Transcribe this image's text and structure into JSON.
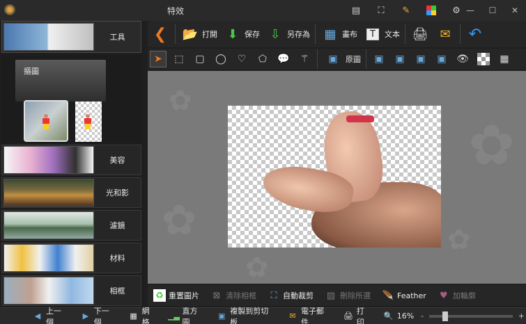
{
  "app": {
    "title": "特效"
  },
  "left": {
    "categories": [
      {
        "label": "工具"
      },
      {
        "label": "美容"
      },
      {
        "label": "光和影"
      },
      {
        "label": "濾鏡"
      },
      {
        "label": "材料"
      },
      {
        "label": "相框"
      }
    ],
    "crop_tab": "摳圖"
  },
  "toolbar": {
    "open": "打開",
    "save": "保存",
    "save_as": "另存為",
    "canvas": "畫布",
    "text": "文本",
    "original": "原圖"
  },
  "actions": {
    "reset": "重置圖片",
    "clear_frame": "清除相框",
    "auto_crop": "自動裁剪",
    "delete_selected": "刪除所選",
    "feather": "Feather",
    "add_outline": "加輪廓"
  },
  "status": {
    "prev": "上一個",
    "next": "下一個",
    "grid": "網格",
    "histogram": "直方圖",
    "copy_clipboard": "複製到剪切板",
    "email": "電子郵件",
    "print": "打印",
    "zoom": "16%",
    "zoom_minus": "-",
    "zoom_plus": "+",
    "zoom_level": 0.16
  }
}
